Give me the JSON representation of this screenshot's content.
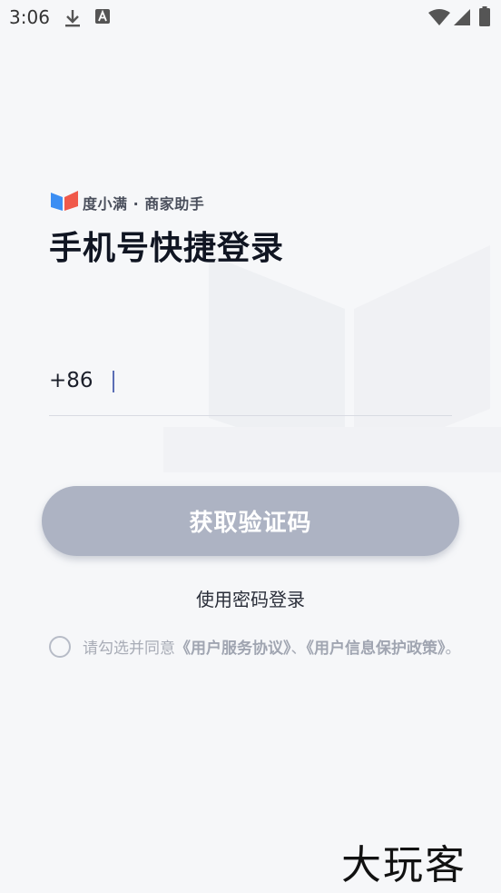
{
  "status_bar": {
    "time": "3:06",
    "icons": [
      "download-icon",
      "a-icon",
      "wifi-icon",
      "signal-icon",
      "battery-icon"
    ]
  },
  "brand": {
    "name": "度小满 · 商家助手",
    "logo": "book-logo-icon",
    "logo_colors": [
      "#3c8ef3",
      "#f0594a"
    ]
  },
  "page": {
    "title": "手机号快捷登录"
  },
  "phone": {
    "country_code": "+86",
    "value": "",
    "placeholder": ""
  },
  "actions": {
    "get_code_label": "获取验证码",
    "password_login_label": "使用密码登录"
  },
  "agreement": {
    "prefix": "请勾选并同意",
    "doc1": "《用户服务协议》",
    "separator": "、",
    "doc2": "《用户信息保护政策》",
    "suffix": "。",
    "checked": false
  },
  "watermark": {
    "text": "大玩客"
  },
  "colors": {
    "background": "#f6f7f9",
    "button_disabled": "#adb3c3",
    "title": "#101522",
    "muted": "#a8acb6"
  }
}
